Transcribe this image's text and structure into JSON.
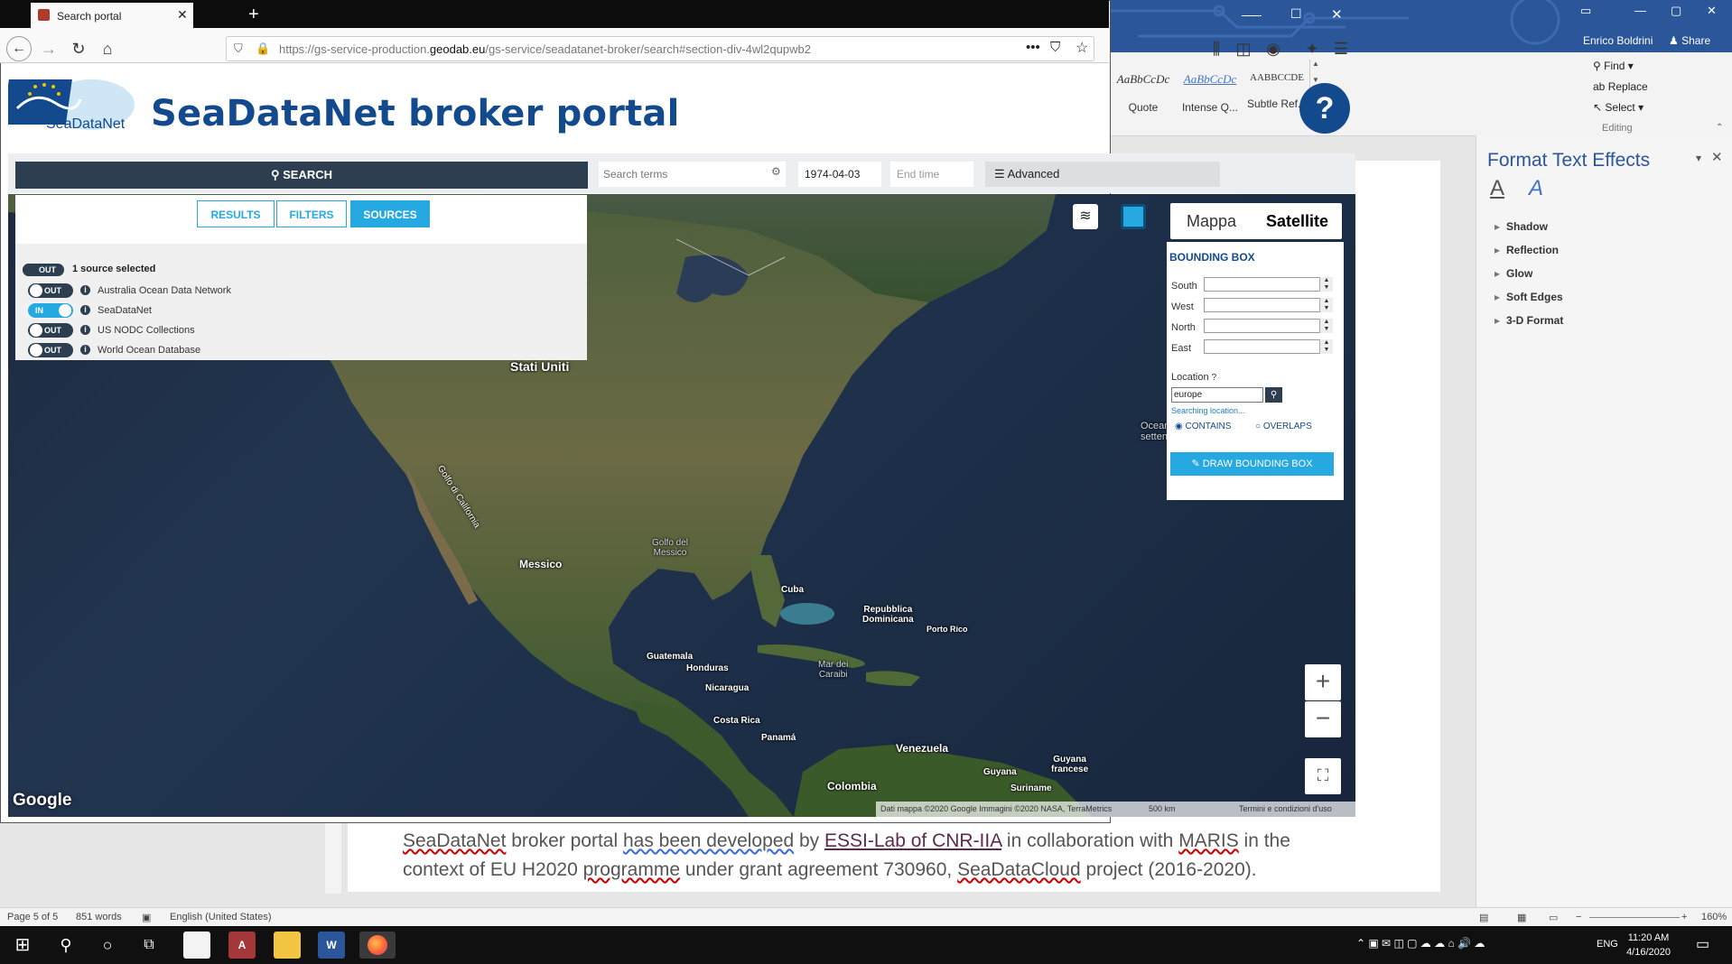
{
  "browser": {
    "tab_title": "Search portal",
    "url_prefix": "https://gs-service-production.",
    "url_domain": "geodab.eu",
    "url_suffix": "/gs-service/seadatanet-broker/search#section-div-4wl2qupwb2"
  },
  "portal": {
    "logo_text": "SeaDataNet",
    "title": "SeaDataNet broker portal",
    "help_label": "?"
  },
  "search": {
    "button_label": "SEARCH",
    "terms_placeholder": "Search terms",
    "start_date": "1974-04-03",
    "end_placeholder": "End time",
    "advanced_label": "Advanced"
  },
  "panel": {
    "tabs": [
      "RESULTS",
      "FILTERS",
      "SOURCES"
    ],
    "summary_toggle": "OUT",
    "summary": "1 source selected",
    "sources": [
      {
        "state": "OUT",
        "name": "Australia Ocean Data Network"
      },
      {
        "state": "IN",
        "name": "SeaDataNet"
      },
      {
        "state": "OUT",
        "name": "US NODC Collections"
      },
      {
        "state": "OUT",
        "name": "World Ocean Database"
      }
    ]
  },
  "map": {
    "type_map": "Mappa",
    "type_satellite": "Satellite",
    "labels": {
      "usa": "Stati Uniti",
      "mexico": "Messico",
      "gulf_california": "Golfo di California",
      "gulf_mexico": "Golfo del\nMessico",
      "cuba": "Cuba",
      "dom_rep": "Repubblica\nDominicana",
      "puerto_rico": "Porto Rico",
      "guatemala": "Guatemala",
      "honduras": "Honduras",
      "nicaragua": "Nicaragua",
      "caribbean": "Mar dei\nCaraibi",
      "costa_rica": "Costa Rica",
      "panama": "Panamá",
      "venezuela": "Venezuela",
      "colombia": "Colombia",
      "guyana": "Guyana",
      "suriname": "Suriname",
      "french_guiana": "Guyana\nfrancese",
      "atlantic": "Oceano A\nsetten"
    },
    "google": "Google",
    "attribution": "Dati mappa ©2020 Google Immagini ©2020 NASA, TerraMetrics",
    "scale": "500 km",
    "terms": "Termini e condizioni d'uso",
    "zoom_in": "+",
    "zoom_out": "−"
  },
  "bbox": {
    "title": "BOUNDING BOX",
    "south": "South",
    "west": "West",
    "north": "North",
    "east": "East",
    "location_label": "Location",
    "location_value": "europe",
    "searching": "Searching location...",
    "contains": "CONTAINS",
    "overlaps": "OVERLAPS",
    "draw_button": "DRAW BOUNDING BOX"
  },
  "word": {
    "user": "Enrico Boldrini",
    "share": "Share",
    "styles": [
      {
        "sample": "AaBbCcDc",
        "name": "Quote"
      },
      {
        "sample": "AaBbCcDc",
        "name": "Intense Q..."
      },
      {
        "sample": "AABBCCDE",
        "name": "Subtle Ref..."
      }
    ],
    "editing": {
      "find": "Find",
      "replace": "Replace",
      "select": "Select",
      "group": "Editing"
    },
    "pane_title": "Format Text Effects",
    "effects": [
      "Shadow",
      "Reflection",
      "Glow",
      "Soft Edges",
      "3-D Format"
    ],
    "doc_text_1": "SeaDataNet",
    "doc_text_2": " broker portal ",
    "doc_text_3": "has been developed",
    "doc_text_4": " by ",
    "doc_text_5": "ESSI-Lab of CNR-IIA",
    "doc_text_6": " in collaboration with ",
    "doc_text_7": "MARIS",
    "doc_text_8": " in the",
    "doc_text_9": "context of EU H2020 ",
    "doc_text_10": "programme",
    "doc_text_11": " under grant agreement 730960, ",
    "doc_text_12": "SeaDataCloud",
    "doc_text_13": " project (2016-2020).",
    "status_page": "Page 5 of 5",
    "status_words": "851 words",
    "status_lang": "English (United States)",
    "status_zoom": "160%"
  },
  "taskbar": {
    "time": "11:20 AM",
    "date": "4/16/2020",
    "lang": "ENG"
  },
  "colors": {
    "accent": "#26a9e0",
    "brand_dark": "#134a8e",
    "search_bg": "#2c3e50",
    "word_blue": "#2b579a"
  }
}
